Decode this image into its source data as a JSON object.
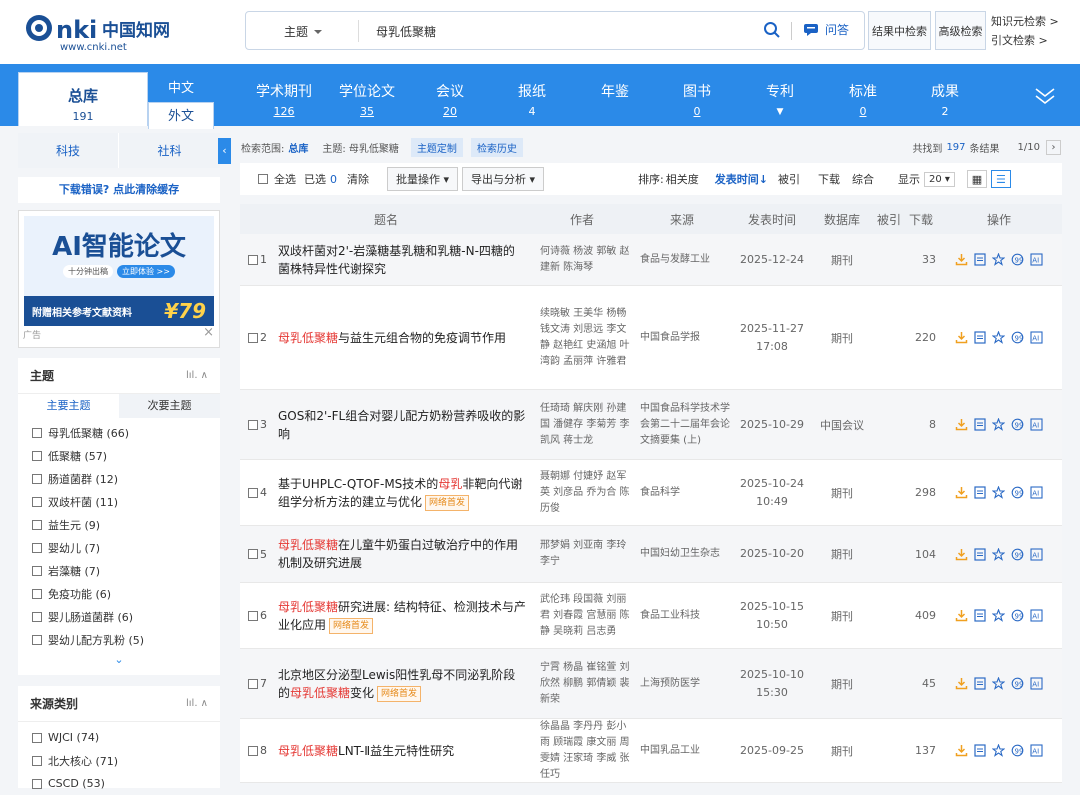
{
  "header": {
    "logo_text": "cnki 中国知网 www.cnki.net",
    "search_field": "主题",
    "query": "母乳低聚糖",
    "ask_label": "问答",
    "btn_in_result": "结果中检索",
    "btn_advanced": "高级检索",
    "link_knowledge": "知识元检索 >",
    "link_citation": "引文检索 >"
  },
  "nav": {
    "total": {
      "label": "总库",
      "count": "191"
    },
    "lang_cn": "中文",
    "lang_en": "外文",
    "items": [
      {
        "label": "学术期刊",
        "count": "126"
      },
      {
        "label": "学位论文",
        "count": "35"
      },
      {
        "label": "会议",
        "count": "20"
      },
      {
        "label": "报纸",
        "count": "4"
      },
      {
        "label": "年鉴",
        "count": ""
      },
      {
        "label": "图书",
        "count": "0"
      },
      {
        "label": "专利",
        "count": ""
      },
      {
        "label": "标准",
        "count": "0"
      },
      {
        "label": "成果",
        "count": "2"
      }
    ]
  },
  "sidebar": {
    "cat_science": "科技",
    "cat_social": "社科",
    "download_error": "下载错误? 点此清除缓存",
    "ad": {
      "title": "AI智能论文",
      "tagline": "十分钟出稿",
      "cta": "立即体验 >>",
      "bottom": "附赠相关参考文献资料",
      "price": "¥79",
      "label": "广告"
    },
    "topic_header": "主题",
    "topic_tab_main": "主要主题",
    "topic_tab_sub": "次要主题",
    "topics": [
      "母乳低聚糖 (66)",
      "低聚糖 (57)",
      "肠道菌群 (12)",
      "双歧杆菌 (11)",
      "益生元 (9)",
      "婴幼儿 (7)",
      "岩藻糖 (7)",
      "免疫功能 (6)",
      "婴儿肠道菌群 (6)",
      "婴幼儿配方乳粉 (5)"
    ],
    "source_header": "来源类别",
    "sources": [
      "WJCI (74)",
      "北大核心 (71)",
      "CSCD (53)"
    ]
  },
  "filter": {
    "scope_label": "检索范围:",
    "scope_value": "总库",
    "topic_label": "主题: 母乳低聚糖",
    "btn_custom": "主题定制",
    "btn_history": "检索历史",
    "found_prefix": "共找到",
    "found_count": "197",
    "found_suffix": "条结果",
    "page": "1/10"
  },
  "toolbar": {
    "select_all": "全选",
    "selected": "已选",
    "selected_count": "0",
    "clear": "清除",
    "batch": "批量操作",
    "export": "导出与分析",
    "sort_label": "排序:",
    "sort_relevance": "相关度",
    "sort_date": "发表时间↓",
    "sort_cited": "被引",
    "sort_download": "下载",
    "sort_overall": "综合",
    "display_label": "显示",
    "display_value": "20"
  },
  "table": {
    "headers": {
      "title": "题名",
      "author": "作者",
      "source": "来源",
      "date": "发表时间",
      "db": "数据库",
      "cited": "被引",
      "download": "下载",
      "ops": "操作"
    },
    "rows": [
      {
        "idx": "1",
        "pre": "",
        "hl": "",
        "post": "双歧杆菌对2'-岩藻糖基乳糖和乳糖-N-四糖的菌株特异性代谢探究",
        "tag": "",
        "authors": "何诗薇 杨波 郭敏 赵建新 陈海琴",
        "source": "食品与发酵工业",
        "date": "2025-12-24",
        "time": "",
        "db": "期刊",
        "cited": "",
        "download": "33"
      },
      {
        "idx": "2",
        "pre": "",
        "hl": "母乳低聚糖",
        "post": "与益生元组合物的免疫调节作用",
        "tag": "",
        "authors": "续晓敏 王美华 杨畅 钱文涛 刘思远 李文静 赵艳红 史涵旭 叶湾韵 孟丽萍 许雅君",
        "source": "中国食品学报",
        "date": "2025-11-27",
        "time": "17:08",
        "db": "期刊",
        "cited": "",
        "download": "220"
      },
      {
        "idx": "3",
        "pre": "GOS和2'-FL组合对婴儿配方奶粉营养吸收的影响",
        "hl": "",
        "post": "",
        "tag": "",
        "authors": "任琦琦 解庆刚 孙建国 潘健存 李菊芳 李凯风 蒋士龙",
        "source": "中国食品科学技术学会第二十二届年会论文摘要集 (上)",
        "date": "2025-10-29",
        "time": "",
        "db": "中国会议",
        "cited": "",
        "download": "8"
      },
      {
        "idx": "4",
        "pre": "基于UHPLC-QTOF-MS技术的",
        "hl": "母乳",
        "post": "非靶向代谢组学分析方法的建立与优化",
        "tag": "网络首发",
        "authors": "聂朝娜 付婕妤 赵军英 刘彦品 乔为合 陈历俊",
        "source": "食品科学",
        "date": "2025-10-24",
        "time": "10:49",
        "db": "期刊",
        "cited": "",
        "download": "298"
      },
      {
        "idx": "5",
        "pre": "",
        "hl": "母乳低聚糖",
        "post": "在儿童牛奶蛋白过敏治疗中的作用机制及研究进展",
        "tag": "",
        "authors": "邢梦娟 刘亚南 李玲 李宁",
        "source": "中国妇幼卫生杂志",
        "date": "2025-10-20",
        "time": "",
        "db": "期刊",
        "cited": "",
        "download": "104"
      },
      {
        "idx": "6",
        "pre": "",
        "hl": "母乳低聚糖",
        "post": "研究进展: 结构特征、检测技术与产业化应用",
        "tag": "网络首发",
        "authors": "武伦玮 段国薇 刘丽君 刘春霞 宫慧丽 陈静 吴晓莉 吕志勇",
        "source": "食品工业科技",
        "date": "2025-10-15",
        "time": "10:50",
        "db": "期刊",
        "cited": "",
        "download": "409"
      },
      {
        "idx": "7",
        "pre": "北京地区分泌型Lewis阳性乳母不同泌乳阶段的",
        "hl": "母乳低聚糖",
        "post": "变化",
        "tag": "网络首发",
        "authors": "宁霄 杨晶 崔铭萱 刘欣然 柳鹏 郭倩颖 裴新荣",
        "source": "上海预防医学",
        "date": "2025-10-10",
        "time": "15:30",
        "db": "期刊",
        "cited": "",
        "download": "45"
      },
      {
        "idx": "8",
        "pre": "",
        "hl": "母乳低聚糖",
        "post": "LNT-Ⅱ益生元特性研究",
        "tag": "",
        "authors": "徐晶晶 李丹丹 彭小雨 顾瑞霞 康文丽 周雯婧 汪家琦 李威 张任巧",
        "source": "中国乳品工业",
        "date": "2025-09-25",
        "time": "",
        "db": "期刊",
        "cited": "",
        "download": "137"
      }
    ]
  },
  "colors": {
    "brand": "#2b8ae8",
    "link": "#1a62c5",
    "highlight": "#e53935",
    "tag": "#e68a1a"
  }
}
